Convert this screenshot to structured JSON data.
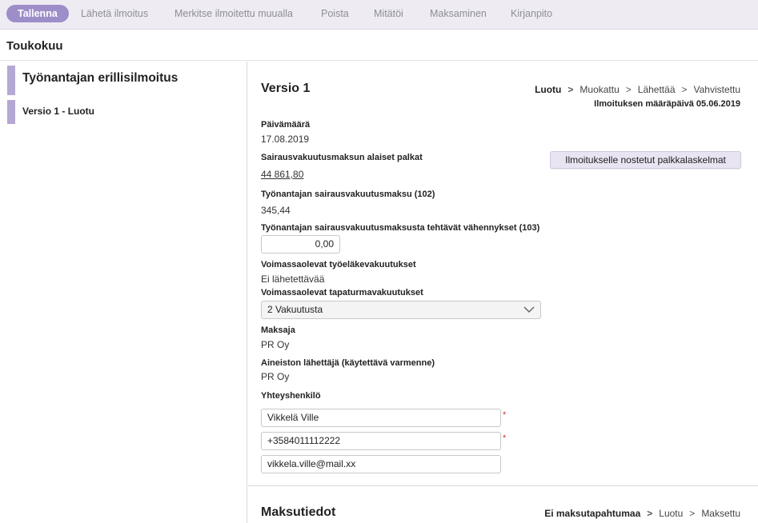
{
  "toolbar": {
    "save": "Tallenna",
    "send": "Lähetä ilmoitus",
    "mark_reported": "Merkitse ilmoitettu muualla",
    "delete": "Poista",
    "void": "Mitätöi",
    "payment": "Maksaminen",
    "accounting": "Kirjanpito"
  },
  "page": {
    "title": "Toukokuu"
  },
  "sidebar": {
    "heading": "Työnantajan erillisilmoitus",
    "items": [
      {
        "label": "Versio 1 - Luotu"
      }
    ]
  },
  "version": {
    "title": "Versio 1",
    "steps": [
      "Luotu",
      "Muokattu",
      "Lähettää",
      "Vahvistettu"
    ],
    "active_step": "Luotu",
    "deadline": "Ilmoituksen määräpäivä 05.06.2019"
  },
  "form": {
    "date_label": "Päivämäärä",
    "date_value": "17.08.2019",
    "wages_label": "Sairausvakuutusmaksun alaiset palkat",
    "wages_value": "44 861,80",
    "payslips_button": "Ilmoitukselle nostetut palkkalaskelmat",
    "fee_label": "Työnantajan sairausvakuutusmaksu (102)",
    "fee_value": "345,44",
    "deductions_label": "Työnantajan sairausvakuutusmaksusta tehtävät vähennykset (103)",
    "deductions_value": "0,00",
    "pension_label": "Voimassaolevat työeläkevakuutukset",
    "pension_value": "Ei lähetettävää",
    "accident_label": "Voimassaolevat tapaturmavakuutukset",
    "accident_value": "2 Vakuutusta",
    "payer_label": "Maksaja",
    "payer_value": "PR Oy",
    "sender_label": "Aineiston lähettäjä (käytettävä varmenne)",
    "sender_value": "PR Oy",
    "contact_label": "Yhteyshenkilö",
    "contact_name": "Vikkelä Ville",
    "contact_phone": "+3584011112222",
    "contact_email": "vikkela.ville@mail.xx",
    "required_mark": "*"
  },
  "payment": {
    "title": "Maksutiedot",
    "steps": [
      "Ei maksutapahtumaa",
      "Luotu",
      "Maksettu"
    ],
    "active_step": "Ei maksutapahtumaa"
  },
  "colors": {
    "accent": "#9d8ec9",
    "sidebar_accent": "#b5a8d4",
    "toolbar_bg": "#eeebf3",
    "required": "#d12f2f"
  }
}
